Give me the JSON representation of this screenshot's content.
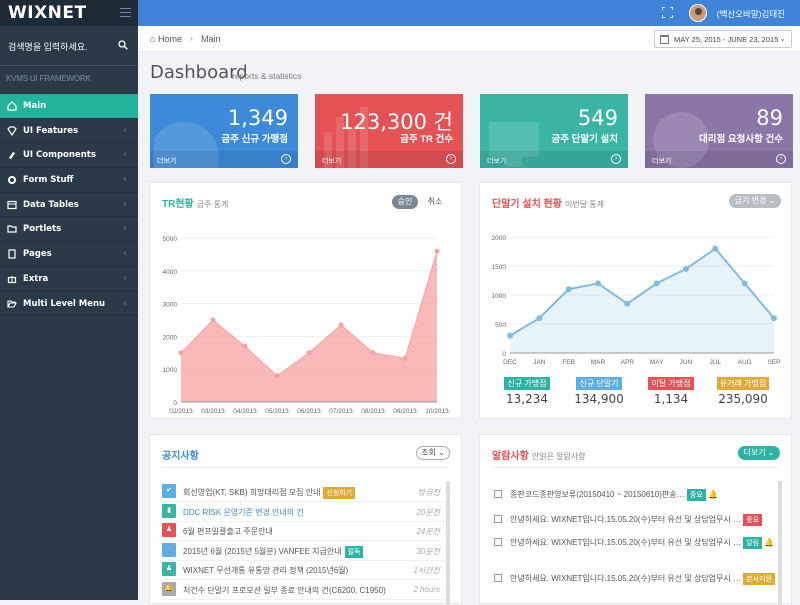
{
  "app": {
    "logo": "WIXNET",
    "username": "(백산오바말)김태진"
  },
  "sidebar": {
    "search_placeholder": "검색명을 입력하세요.",
    "heading": "KVMS UI FRAMEWORK",
    "items": [
      {
        "label": "Main",
        "icon": "home-icon",
        "active": true
      },
      {
        "label": "UI Features",
        "icon": "diamond-icon"
      },
      {
        "label": "UI Components",
        "icon": "brush-icon"
      },
      {
        "label": "Form Stuff",
        "icon": "gear-icon"
      },
      {
        "label": "Data Tables",
        "icon": "table-icon"
      },
      {
        "label": "Portlets",
        "icon": "folder-icon"
      },
      {
        "label": "Pages",
        "icon": "document-icon"
      },
      {
        "label": "Extra",
        "icon": "gift-icon"
      },
      {
        "label": "Multi Level Menu",
        "icon": "folder-open-icon"
      }
    ]
  },
  "breadcrumb": {
    "home": "Home",
    "current": "Main"
  },
  "daterange": "MAY 25, 2015 - JUNE 23, 2015",
  "page": {
    "title": "Dashboard",
    "subtitle": "reports & statistics"
  },
  "stats": [
    {
      "number": "1,349",
      "label": "금주 신규 가맹점",
      "more": "더보기",
      "color": "#3c8ad8"
    },
    {
      "number": "123,300 건",
      "label": "금주 TR 건수",
      "more": "더보기",
      "color": "#e45255"
    },
    {
      "number": "549",
      "label": "금주 단말기 설치",
      "more": "더보기",
      "color": "#3ab5a5"
    },
    {
      "number": "89",
      "label": "대리점 요청사항 건수",
      "more": "더보기",
      "color": "#8b76a8"
    }
  ],
  "tr_panel": {
    "title": "TR현황",
    "subtitle": "금주 통계",
    "btn_approve": "승인",
    "btn_cancel": "취소"
  },
  "install_panel": {
    "title": "단말기 설치 현황",
    "subtitle": "이번달 통계",
    "btn": "금기 변경"
  },
  "chart_data": [
    {
      "type": "area",
      "title": "TR현황",
      "categories": [
        "02/2013",
        "03/2013",
        "04/2013",
        "05/2013",
        "06/2013",
        "07/2013",
        "08/2013",
        "09/2013",
        "10/2013"
      ],
      "series": [
        {
          "values": [
            1500,
            2500,
            1700,
            800,
            1500,
            2350,
            1500,
            1330,
            4600
          ]
        }
      ],
      "yticks": [
        "0",
        "1000",
        "2000",
        "3000",
        "4000",
        "5000"
      ],
      "ylim": [
        0,
        5000
      ],
      "color": "#f7a2a2",
      "grid": true
    },
    {
      "type": "area",
      "title": "단말기 설치 현황",
      "categories": [
        "DEC",
        "JAN",
        "FEB",
        "MAR",
        "APR",
        "MAY",
        "JUN",
        "JUL",
        "AUG",
        "SEP"
      ],
      "series": [
        {
          "values": [
            300,
            600,
            1100,
            1200,
            850,
            1200,
            1450,
            1800,
            1200,
            600
          ]
        }
      ],
      "yticks": [
        "0",
        "500",
        "1000",
        "1500",
        "2000"
      ],
      "ylim": [
        0,
        2000
      ],
      "color": "#7fbde0",
      "grid": true
    }
  ],
  "install_legend": [
    {
      "label": "신규 가맹점",
      "value": "13,234",
      "color": "#2bb3a3"
    },
    {
      "label": "신규 단말기",
      "value": "134,900",
      "color": "#5daee5"
    },
    {
      "label": "이탈 가맹점",
      "value": "1,134",
      "color": "#e45255"
    },
    {
      "label": "유거래 가맹점",
      "value": "235,090",
      "color": "#e0aa35"
    }
  ],
  "notices": {
    "title": "공지사항",
    "btn": "조회",
    "rows": [
      {
        "text": "회선영업(KT, SKB) 희망대리점 모집 안내",
        "tag": "신청하기",
        "tag_color": "#e0aa35",
        "date": "방금전",
        "icon_color": "#5daee5"
      },
      {
        "text": "DDC RISK 운영기준 변경 안내의 건",
        "tag": "",
        "date": "20분전",
        "icon_color": "#3ab5a5",
        "link": true
      },
      {
        "text": "6월 편프일괄출고 주문안내",
        "tag": "",
        "date": "24분전",
        "icon_color": "#e45255"
      },
      {
        "text": "2015년 6월 (2015년 5월분) VANFEE 지급안내",
        "tag": "필독",
        "tag_color": "#2bb3a3",
        "date": "30분전",
        "icon_color": "#5daee5"
      },
      {
        "text": "WIXNET 무선개통 유통망 관리 정책 (2015년6월)",
        "tag": "",
        "date": "1시간전",
        "icon_color": "#3ab5a5"
      },
      {
        "text": "처건수 단말기 프로모션 일부 종료 안내의 건(C6200, C1950)",
        "tag": "",
        "date": "2 hours",
        "icon_color": "#aaaaaa"
      }
    ]
  },
  "alarms": {
    "title": "알람사항",
    "subtitle": "안읽은 알람사항",
    "btn": "더보기",
    "rows": [
      {
        "text": "종판코드종판영보류(20150410 ~ 20150610)판송…",
        "tag": "중요",
        "tag_color": "#2bb3a3",
        "bell": true
      },
      {
        "text": "안녕하세요. WIXNET입니다.15.05.20(수)부터 유선 및 상담업무시 …",
        "tag": "중요",
        "tag_color": "#e45255"
      },
      {
        "text": "안녕하세요. WIXNET입니다.15.05.20(수)부터 유선 및 상담업무시 …",
        "tag": "알림",
        "tag_color": "#2bb3a3",
        "bell": true
      },
      {
        "text": "안녕하세요. WIXNET입니다.15.05.20(수)부터 유선 및 상담업무시 …",
        "tag": "본사지원",
        "tag_color": "#e0aa35"
      }
    ]
  }
}
